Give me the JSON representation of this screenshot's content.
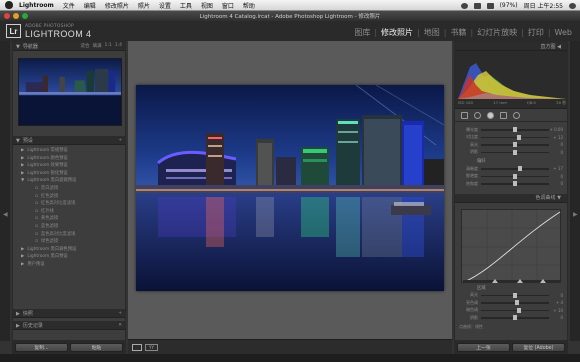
{
  "menubar": {
    "app_name": "Lightroom",
    "items": [
      "文件",
      "编辑",
      "修改照片",
      "照片",
      "设置",
      "工具",
      "视图",
      "窗口",
      "帮助"
    ],
    "right_status": "(97%)",
    "clock": "周日 上午2:55"
  },
  "window": {
    "title": "Lightroom 4 Catalog.lrcat - Adobe Photoshop Lightroom - 修改照片"
  },
  "identity": {
    "logo": "Lr",
    "subtitle": "ADOBE PHOTOSHOP",
    "name": "LIGHTROOM 4"
  },
  "modules": {
    "items": [
      "图库",
      "修改照片",
      "地图",
      "书籍",
      "幻灯片放映",
      "打印",
      "Web"
    ],
    "active_index": 1
  },
  "left_panel": {
    "navigator_label": "导航器",
    "zoom_options": [
      "适合",
      "填满",
      "1:1",
      "1:4"
    ],
    "presets_label": "预设",
    "presets": [
      {
        "label": "Lightroom 常规预设",
        "child": false
      },
      {
        "label": "Lightroom 颜色预设",
        "child": false
      },
      {
        "label": "Lightroom 效果预设",
        "child": false
      },
      {
        "label": "Lightroom 锐化预设",
        "child": false
      },
      {
        "label": "Lightroom 黑白滤镜预设",
        "child": false
      },
      {
        "label": "黑白滤镜",
        "child": true
      },
      {
        "label": "红色滤镜",
        "child": true
      },
      {
        "label": "红色高对比度滤镜",
        "child": true
      },
      {
        "label": "红外线",
        "child": true
      },
      {
        "label": "黄色滤镜",
        "child": true
      },
      {
        "label": "蓝色滤镜",
        "child": true
      },
      {
        "label": "蓝色高对比度滤镜",
        "child": true
      },
      {
        "label": "绿色滤镜",
        "child": true
      },
      {
        "label": "Lightroom 黑白调色预设",
        "child": false
      },
      {
        "label": "Lightroom 黑白预设",
        "child": false
      },
      {
        "label": "用户预设",
        "child": false
      }
    ],
    "snapshots_label": "快照",
    "history_label": "历史记录",
    "copy_button": "复制...",
    "paste_button": "粘贴"
  },
  "right_panel": {
    "histogram_label": "直方图",
    "histogram_info": [
      "ISO 100",
      "17 mm",
      "f/8.0",
      "30 秒"
    ],
    "basic_sliders": [
      {
        "label": "曝光度",
        "value": "+ 0.00",
        "pos": 0.5
      },
      {
        "label": "对比度",
        "value": "+ 12",
        "pos": 0.56
      },
      {
        "label": "高光",
        "value": "0",
        "pos": 0.5
      },
      {
        "label": "阴影",
        "value": "0",
        "pos": 0.5
      }
    ],
    "presence_label": "偏好",
    "presence_sliders": [
      {
        "label": "清晰度",
        "value": "+ 17",
        "pos": 0.58
      },
      {
        "label": "鲜艳度",
        "value": "0",
        "pos": 0.5
      },
      {
        "label": "饱和度",
        "value": "0",
        "pos": 0.5
      }
    ],
    "tone_curve_label": "色调曲线",
    "region_label": "区域",
    "curve_sliders": [
      {
        "label": "高光",
        "value": "0",
        "pos": 0.5
      },
      {
        "label": "亮色调",
        "value": "+ 4",
        "pos": 0.53
      },
      {
        "label": "暗色调",
        "value": "+ 10",
        "pos": 0.56
      },
      {
        "label": "阴影",
        "value": "0",
        "pos": 0.5
      }
    ],
    "point_curve_label": "点曲线：线性",
    "prev_button": "上一张",
    "reset_button": "复位 (Adobe)"
  },
  "histogram_colors": {
    "red": "#c8322a",
    "yellow": "#d8c43a",
    "green": "#3aa040",
    "blue": "#3a5ad0",
    "gray": "#9a9a9a"
  }
}
